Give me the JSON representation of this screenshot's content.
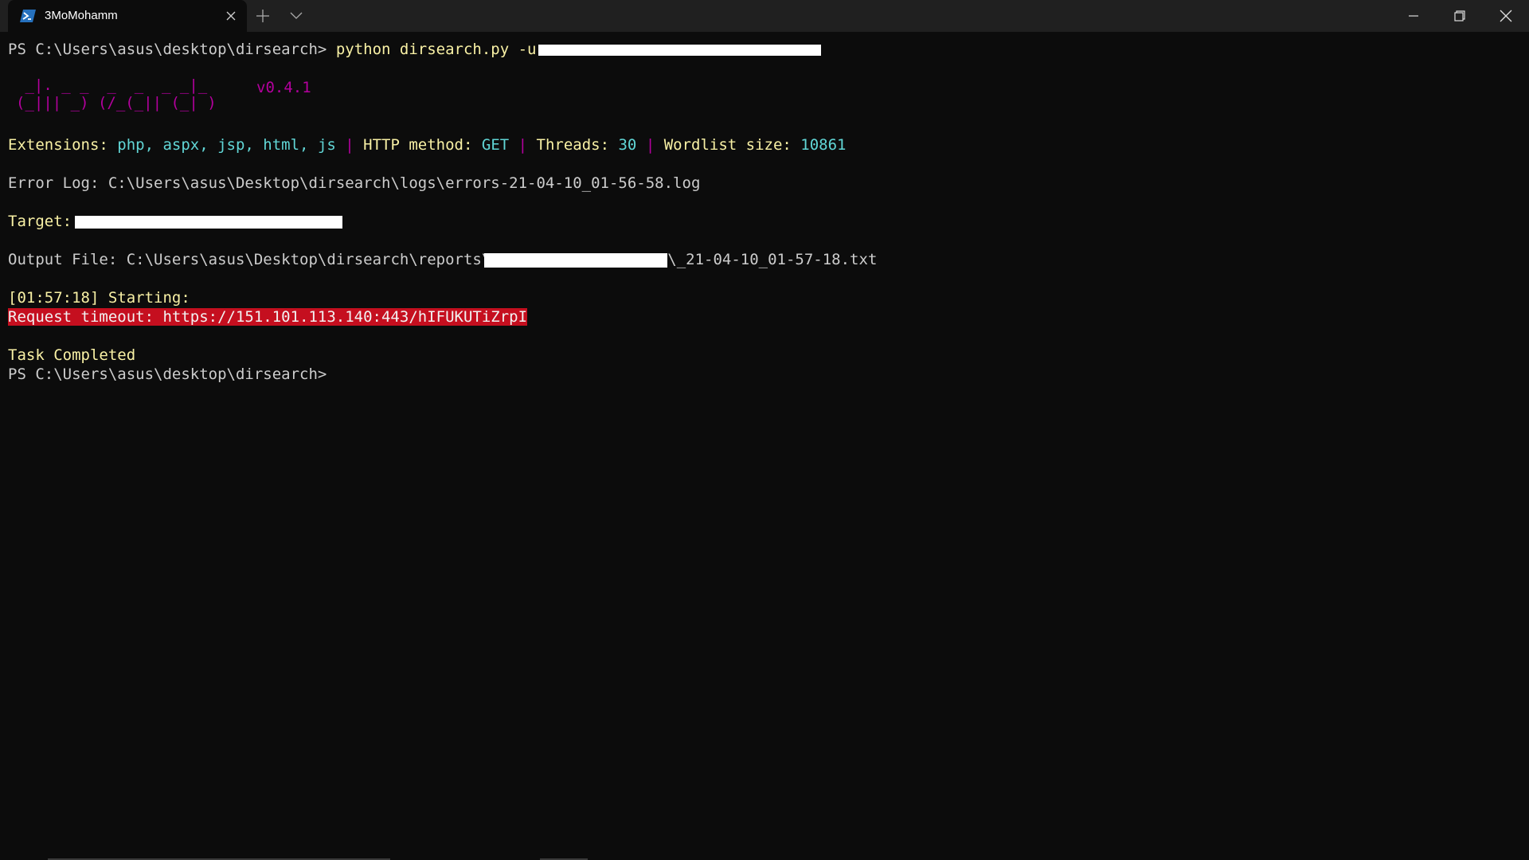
{
  "window": {
    "tab_title": "3MoMohamm",
    "tab_icon": "powershell-icon",
    "controls": [
      "minimize-icon",
      "restore-icon",
      "close-icon"
    ]
  },
  "terminal": {
    "prompt": "PS C:\\Users\\asus\\desktop\\dirsearch>",
    "command": "python dirsearch.py -u",
    "banner_art_line1": " _|. _ _  _  _  _ _|_",
    "banner_art_line2": "(_||| _) (/_(_|| (_| )",
    "version": "v0.4.1",
    "config": {
      "extensions_label": "Extensions: ",
      "extensions_value": "php, aspx, jsp, html, js",
      "separator": " | ",
      "method_label": "HTTP method: ",
      "method_value": "GET",
      "threads_label": "Threads: ",
      "threads_value": "30",
      "wordlist_label": "Wordlist size: ",
      "wordlist_value": "10861"
    },
    "error_log_label": "Error Log: ",
    "error_log_path": "C:\\Users\\asus\\Desktop\\dirsearch\\logs\\errors-21-04-10_01-56-58.log",
    "target_label": "Target: ",
    "output_label": "Output File: ",
    "output_path_prefix": "C:\\Users\\asus\\Desktop\\dirsearch\\reports\\",
    "output_path_suffix": "\\_21-04-10_01-57-18.txt",
    "starting": "[01:57:18] Starting: ",
    "error_line": "Request timeout: https://151.101.113.140:443/hIFUKUTiZrpI",
    "task_completed": "Task Completed",
    "final_prompt": "PS C:\\Users\\asus\\desktop\\dirsearch>"
  },
  "colors": {
    "background": "#0c0c0c",
    "titlebar": "#202020",
    "yellow": "#f9f1a5",
    "cyan": "#61d6d6",
    "magenta": "#b4009e",
    "error_bg": "#c50f1f"
  }
}
